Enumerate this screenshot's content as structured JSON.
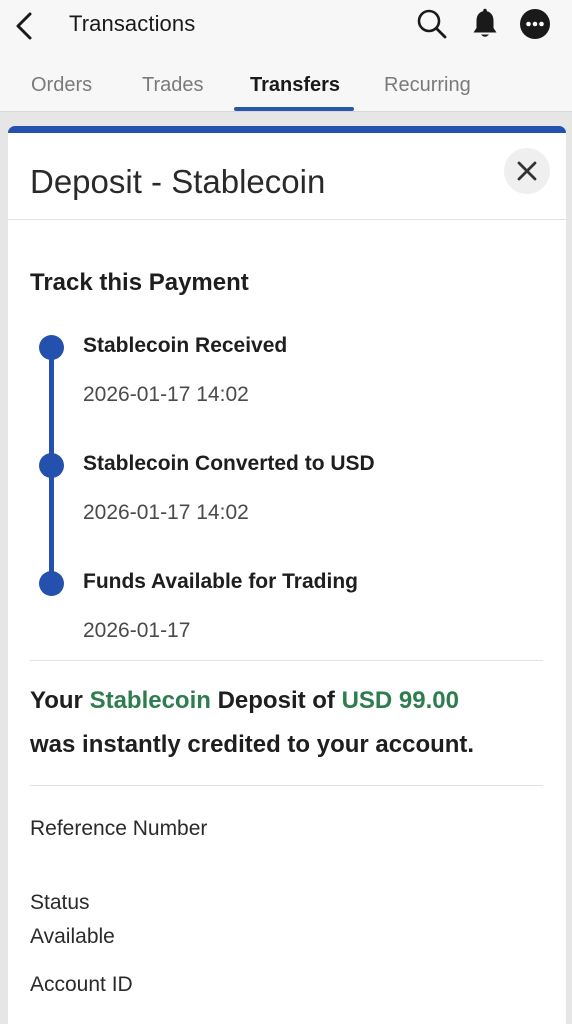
{
  "header": {
    "title": "Transactions",
    "back_icon": "chevron-left-icon",
    "icons": [
      "search-icon",
      "bell-icon",
      "more-icon"
    ]
  },
  "tabs": [
    {
      "label": "Orders",
      "active": false
    },
    {
      "label": "Trades",
      "active": false
    },
    {
      "label": "Transfers",
      "active": true
    },
    {
      "label": "Recurring",
      "active": false
    }
  ],
  "modal": {
    "title": "Deposit - Stablecoin",
    "close_icon": "close-icon",
    "accent_color": "#2451ad",
    "track_title": "Track this Payment",
    "steps": [
      {
        "label": "Stablecoin Received",
        "time": "2026-01-17 14:02"
      },
      {
        "label": "Stablecoin Converted to USD",
        "time": "2026-01-17 14:02"
      },
      {
        "label": "Funds Available for Trading",
        "time": "2026-01-17"
      }
    ],
    "summary": {
      "prefix": "Your ",
      "asset": "Stablecoin",
      "middle": " Deposit of ",
      "amount": "USD 99.00",
      "suffix": "was instantly credited to your account.",
      "highlight_color": "#2e7d4f"
    },
    "details": {
      "reference_label": "Reference Number",
      "status_label": "Status",
      "status_value": "Available",
      "account_label": "Account ID"
    }
  }
}
